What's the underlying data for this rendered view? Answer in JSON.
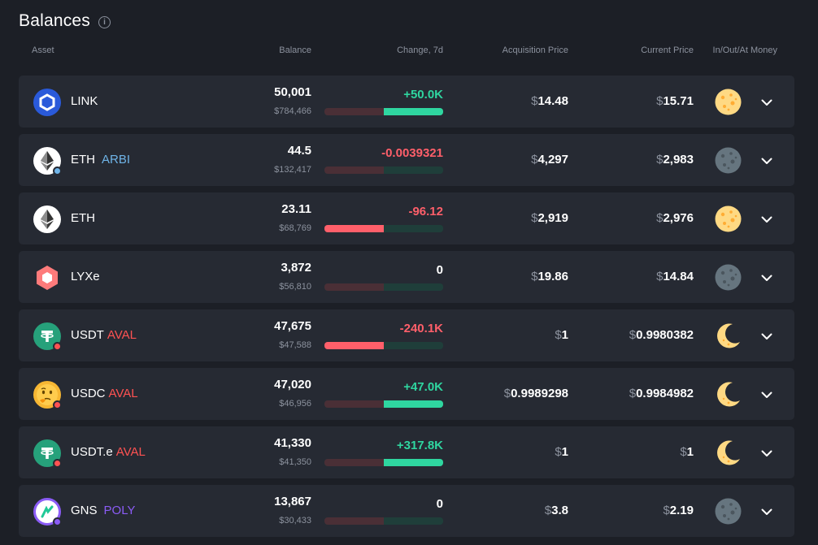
{
  "page": {
    "title": "Balances"
  },
  "headers": {
    "asset": "Asset",
    "balance": "Balance",
    "change": "Change, 7d",
    "acquisition": "Acquisition Price",
    "current": "Current Price",
    "money": "In/Out/At Money"
  },
  "colors": {
    "positive": "#2fd6a0",
    "negative": "#ff5f6a",
    "arbi": "#6fb4e8",
    "aval": "#ff5252",
    "poly": "#8b5cf6"
  },
  "rows": [
    {
      "symbol": "LINK",
      "chain": "",
      "chain_color": "",
      "icon": "chainlink-icon",
      "balance": "50,001",
      "balance_usd": "$784,466",
      "change": "+50.0K",
      "change_dir": "pos",
      "change_fill": 1.0,
      "acq_currency": "$",
      "acq_value": "14.48",
      "cur_currency": "$",
      "cur_value": "15.71",
      "money": "full-moon-icon"
    },
    {
      "symbol": "ETH",
      "chain": "ARBI",
      "chain_color": "#6fb4e8",
      "icon": "ethereum-icon",
      "balance": "44.5",
      "balance_usd": "$132,417",
      "change": "-0.0039321",
      "change_dir": "neg",
      "change_fill": 0.0,
      "acq_currency": "$",
      "acq_value": "4,297",
      "cur_currency": "$",
      "cur_value": "2,983",
      "money": "new-moon-icon"
    },
    {
      "symbol": "ETH",
      "chain": "",
      "chain_color": "",
      "icon": "ethereum-icon",
      "balance": "23.11",
      "balance_usd": "$68,769",
      "change": "-96.12",
      "change_dir": "neg",
      "change_fill": 1.0,
      "acq_currency": "$",
      "acq_value": "2,919",
      "cur_currency": "$",
      "cur_value": "2,976",
      "money": "full-moon-icon"
    },
    {
      "symbol": "LYXe",
      "chain": "",
      "chain_color": "",
      "icon": "lukso-icon",
      "balance": "3,872",
      "balance_usd": "$56,810",
      "change": "0",
      "change_dir": "zero",
      "change_fill": 0.0,
      "acq_currency": "$",
      "acq_value": "19.86",
      "cur_currency": "$",
      "cur_value": "14.84",
      "money": "new-moon-icon"
    },
    {
      "symbol": "USDT",
      "chain": "AVAL",
      "chain_color": "#ff5252",
      "icon": "tether-icon",
      "balance": "47,675",
      "balance_usd": "$47,588",
      "change": "-240.1K",
      "change_dir": "neg",
      "change_fill": 1.0,
      "acq_currency": "$",
      "acq_value": "1",
      "cur_currency": "$",
      "cur_value": "0.9980382",
      "money": "crescent-moon-icon"
    },
    {
      "symbol": "USDC",
      "chain": "AVAL",
      "chain_color": "#ff5252",
      "icon": "thinking-face-icon",
      "balance": "47,020",
      "balance_usd": "$46,956",
      "change": "+47.0K",
      "change_dir": "pos",
      "change_fill": 1.0,
      "acq_currency": "$",
      "acq_value": "0.9989298",
      "cur_currency": "$",
      "cur_value": "0.9984982",
      "money": "crescent-moon-icon"
    },
    {
      "symbol": "USDT.e",
      "chain": "AVAL",
      "chain_color": "#ff5252",
      "icon": "tether-icon",
      "balance": "41,330",
      "balance_usd": "$41,350",
      "change": "+317.8K",
      "change_dir": "pos",
      "change_fill": 1.0,
      "acq_currency": "$",
      "acq_value": "1",
      "cur_currency": "$",
      "cur_value": "1",
      "money": "crescent-moon-icon"
    },
    {
      "symbol": "GNS",
      "chain": "POLY",
      "chain_color": "#8b5cf6",
      "icon": "gains-network-icon",
      "balance": "13,867",
      "balance_usd": "$30,433",
      "change": "0",
      "change_dir": "zero",
      "change_fill": 0.0,
      "acq_currency": "$",
      "acq_value": "3.8",
      "cur_currency": "$",
      "cur_value": "2.19",
      "money": "new-moon-icon"
    }
  ]
}
